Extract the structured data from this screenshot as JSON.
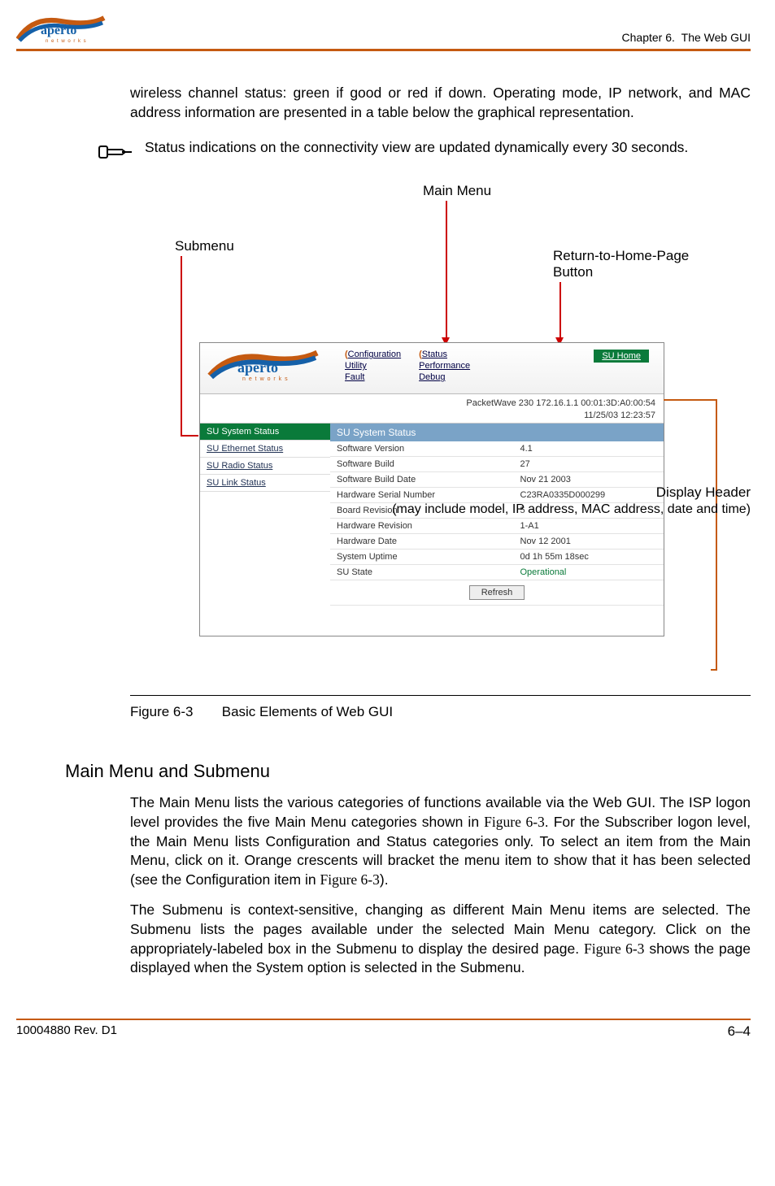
{
  "header": {
    "chapter_prefix": "Chapter 6.",
    "chapter_title": "The Web GUI"
  },
  "para1": "wireless channel status: green if good or red if down. Operating mode, IP network, and MAC address information are presented in a table below the graphical representation.",
  "note": "Status indications on the connectivity view are updated dynamically every 30 seconds.",
  "callouts": {
    "main_menu": "Main Menu",
    "submenu": "Submenu",
    "return_home_l1": "Return-to-Home-Page",
    "return_home_l2": "Button",
    "display_header_l1": "Display Header",
    "display_header_l2": "(may include model, IP address, MAC address, date and time)"
  },
  "screenshot": {
    "logo_text": "aperto",
    "logo_sub": "n e t w o r k s",
    "menu_col1": [
      "Configuration",
      "Utility",
      "Fault"
    ],
    "menu_col2": [
      "Status",
      "Performance",
      "Debug"
    ],
    "home_btn": "SU Home",
    "infobar_l1": "PacketWave 230    172.16.1.1    00:01:3D:A0:00:54",
    "infobar_l2": "11/25/03    12:23:57",
    "submenu_items": [
      "SU System Status",
      "SU Ethernet Status",
      "SU Radio Status",
      "SU Link Status"
    ],
    "panel_title": "SU System Status",
    "rows": [
      {
        "label": "Software Version",
        "value": "4.1"
      },
      {
        "label": "Software Build",
        "value": "27"
      },
      {
        "label": "Software Build Date",
        "value": "Nov 21 2003"
      },
      {
        "label": "Hardware Serial Number",
        "value": "C23RA0335D000299"
      },
      {
        "label": "Board Revision",
        "value": "5"
      },
      {
        "label": "Hardware Revision",
        "value": "1-A1"
      },
      {
        "label": "Hardware Date",
        "value": "Nov 12 2001"
      },
      {
        "label": "System Uptime",
        "value": "0d 1h 55m 18sec"
      },
      {
        "label": "SU State",
        "value": "Operational"
      }
    ],
    "refresh": "Refresh"
  },
  "figure": {
    "num": "Figure 6-3",
    "title": "Basic Elements of Web GUI"
  },
  "section_heading": "Main Menu and Submenu",
  "para2a": "The Main Menu lists the various categories of functions available via the Web GUI. The ISP logon level provides the five Main Menu categories shown in ",
  "para2b": ". For the Subscriber logon level, the Main Menu lists Configuration and Status categories only. To select an item from the Main Menu, click on it. Orange crescents will bracket the menu item to show that it has been selected (see the Configuration item in ",
  "para2c": ").",
  "para3a": "The Submenu is context-sensitive, changing as different Main Menu items are selected. The Submenu lists the pages available under the selected Main Menu category. Click on the appropriately-labeled box in the Submenu to display the desired page. ",
  "para3b": " shows the page displayed when the System option is selected in the Submenu.",
  "fig_ref": "Figure 6-3",
  "footer": {
    "doc_id": "10004880 Rev. D1",
    "page": "6–4"
  }
}
